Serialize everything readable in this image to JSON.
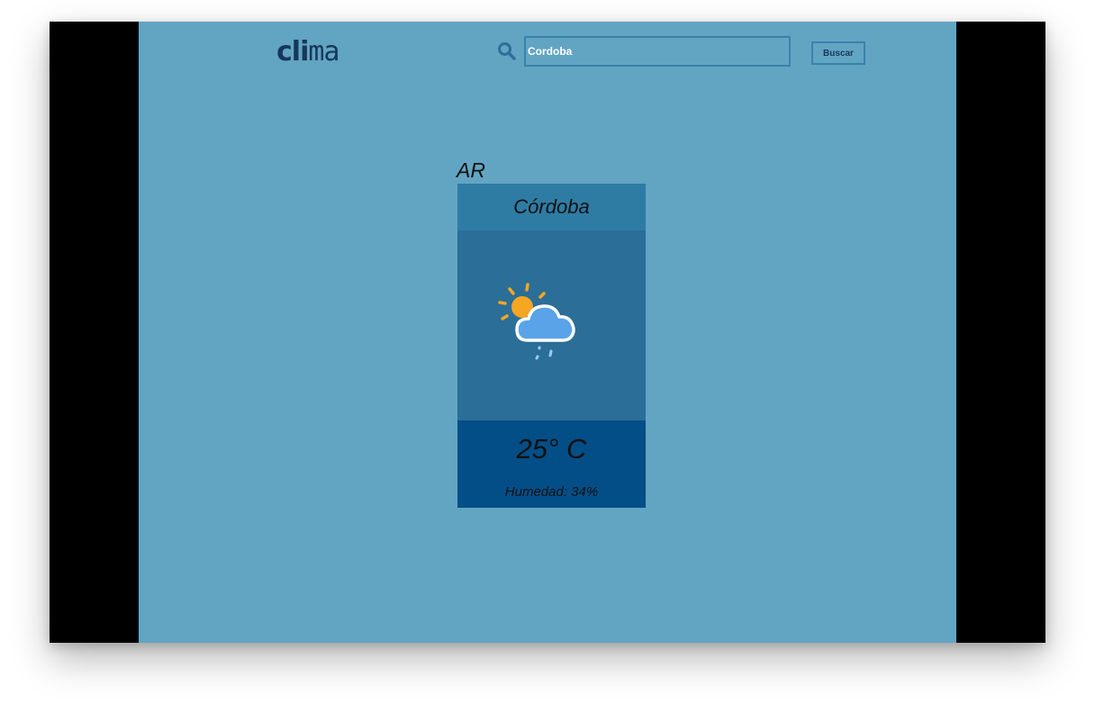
{
  "header": {
    "logo_text": "clima",
    "search": {
      "value": "Cordoba",
      "icon": "search-icon"
    },
    "search_button_label": "Buscar"
  },
  "result": {
    "country": "AR",
    "city": "Córdoba",
    "weather_icon": "partly-cloudy-rain-icon",
    "temperature": "25° C",
    "humidity": "Humedad: 34%"
  },
  "colors": {
    "background": "#62a5c3",
    "card_header": "#2e7ca4",
    "card_body": "#2b6e97",
    "card_footer": "#034e87",
    "logo": "#17375a"
  }
}
